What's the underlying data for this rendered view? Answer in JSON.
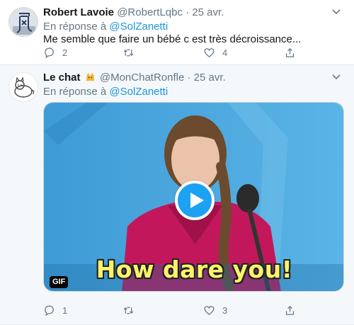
{
  "tweets": [
    {
      "name": "Robert Lavoie",
      "handle": "@RobertLqbc",
      "dot": "·",
      "date": "25 avr.",
      "replying_prefix": "En réponse à",
      "replying_to": "@SolZanetti",
      "text": "Me semble que faire un bébé c est très décroissance...",
      "replies": "2",
      "retweets": "",
      "likes": "4"
    },
    {
      "name": "Le chat",
      "name_emoji": "cat-emoji-icon",
      "handle": "@MonChatRonfle",
      "dot": "·",
      "date": "25 avr.",
      "replying_prefix": "En réponse à",
      "replying_to": "@SolZanetti",
      "media": {
        "caption": "How dare you!",
        "badge": "GIF"
      },
      "replies": "1",
      "retweets": "",
      "likes": "3"
    }
  ],
  "colors": {
    "accent": "#1da1f2",
    "link": "#1b95e0",
    "muted": "#657786"
  }
}
